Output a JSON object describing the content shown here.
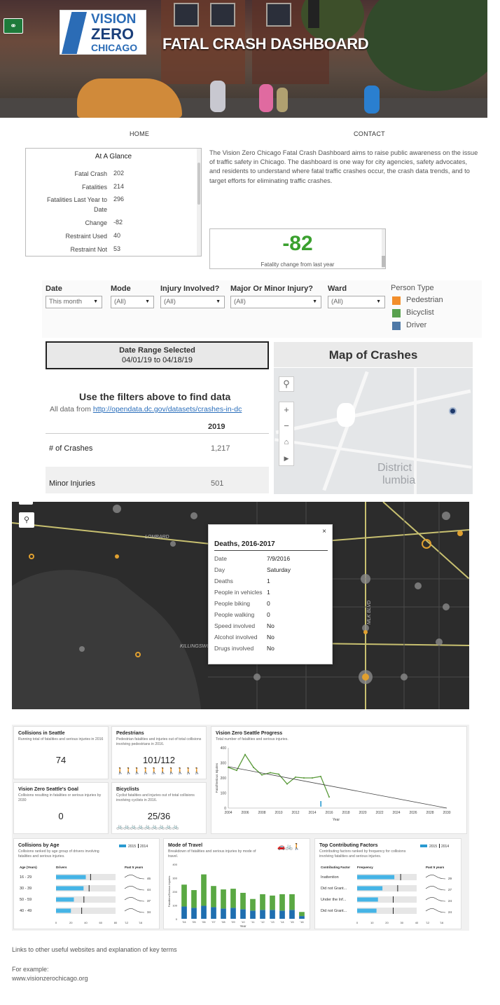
{
  "header": {
    "logo_line1": "VISION",
    "logo_line2": "ZERO",
    "logo_line3": "CHICAGO",
    "title": "FATAL CRASH DASHBOARD"
  },
  "nav": {
    "home": "HOME",
    "contact": "CONTACT"
  },
  "glance": {
    "title": "At A Glance",
    "rows": [
      {
        "label": "Fatal Crash",
        "value": "202"
      },
      {
        "label": "Fatalities",
        "value": "214"
      },
      {
        "label": "Fatalities Last Year to Date",
        "value": "296"
      },
      {
        "label": "Change",
        "value": "-82"
      },
      {
        "label": "Restraint Used",
        "value": "40"
      },
      {
        "label": "Restraint Not",
        "value": "53"
      }
    ]
  },
  "intro": "The Vision Zero Chicago Fatal Crash Dashboard aims to raise public awareness on the issue of traffic safety in Chicago. The dashboard is one way for city agencies, safety advocates, and residents to understand where fatal traffic crashes occur, the crash data trends, and to target efforts for eliminating traffic crashes.",
  "change": {
    "value": "-82",
    "caption": "Fatality change from last year",
    "color": "#3aa02e"
  },
  "filters": {
    "date": {
      "label": "Date",
      "value": "This month"
    },
    "mode": {
      "label": "Mode",
      "value": "(All)"
    },
    "injury": {
      "label": "Injury Involved?",
      "value": "(All)"
    },
    "severity": {
      "label": "Major Or Minor Injury?",
      "value": "(All)"
    },
    "ward": {
      "label": "Ward",
      "value": "(All)"
    }
  },
  "legend": {
    "title": "Person Type",
    "items": [
      {
        "label": "Pedestrian",
        "color": "#f28e2b"
      },
      {
        "label": "Bicyclist",
        "color": "#59a14f"
      },
      {
        "label": "Driver",
        "color": "#4e79a7"
      }
    ]
  },
  "date_range": {
    "title": "Date Range Selected",
    "value": "04/01/19 to 04/18/19"
  },
  "map": {
    "title": "Map of Crashes",
    "label1": "District",
    "label2": "lumbia"
  },
  "data_table": {
    "heading": "Use the filters above to find data",
    "source_prefix": "All data from ",
    "source_link": "http://opendata.dc.gov/datasets/crashes-in-dc",
    "year": "2019",
    "rows": [
      {
        "label": "# of Crashes",
        "value": "1,217"
      },
      {
        "label": "Minor Injuries",
        "value": "501"
      }
    ]
  },
  "dark_map": {
    "popup": {
      "title": "Deaths, 2016-2017",
      "close": "×",
      "rows": [
        {
          "label": "Date",
          "value": "7/9/2016"
        },
        {
          "label": "Day",
          "value": "Saturday"
        },
        {
          "label": "Deaths",
          "value": "1"
        },
        {
          "label": "People in vehicles",
          "value": "1"
        },
        {
          "label": "People biking",
          "value": "0"
        },
        {
          "label": "People walking",
          "value": "0"
        },
        {
          "label": "Speed involved",
          "value": "No"
        },
        {
          "label": "Alcohol involved",
          "value": "No"
        },
        {
          "label": "Drugs involved",
          "value": "No"
        }
      ]
    },
    "streets": [
      "LOMBARD",
      "KILLINGSWORTH",
      "MLK BLVD"
    ]
  },
  "seattle": {
    "collisions": {
      "title": "Collisions in Seattle",
      "sub": "Running total of fatalities and serious injuries in 2016",
      "value": "74"
    },
    "pedestrians": {
      "title": "Pedestrians",
      "sub": "Pedestrian fatalities and injuries out of total collisions involving pedestrians in 2016.",
      "value": "101/112"
    },
    "goal": {
      "title": "Vision Zero Seattle's Goal",
      "sub": "Collisions resulting in fatalities or serious injuries by 2030",
      "value": "0"
    },
    "bicyclists": {
      "title": "Bicyclists",
      "sub": "Cyclist fatalities and injuries out of total collisions involving cyclists in 2016.",
      "value": "25/36"
    },
    "progress": {
      "title": "Vision Zero Seattle Progress",
      "sub": "Total number of fatalities and serious injuries.",
      "ylabel": "Fatal/Serious Injuries",
      "xlabel": "Year"
    },
    "age": {
      "title": "Collisions by Age",
      "sub": "Collisions ranked by age group of drivers involving fatalities and serious injuries.",
      "col1": "Age (Years)",
      "col2": "Drivers",
      "col3": "Past 5 years",
      "legend_a": "2015",
      "legend_b": "2014",
      "rows": [
        {
          "label": "16 - 29",
          "value": 40,
          "tick": 46,
          "spark": "46"
        },
        {
          "label": "30 - 39",
          "value": 37,
          "tick": 44,
          "spark": "44"
        },
        {
          "label": "50 - 59",
          "value": 24,
          "tick": 37,
          "spark": "37"
        },
        {
          "label": "40 - 49",
          "value": 20,
          "tick": 34,
          "spark": "34"
        }
      ],
      "axis": [
        "0",
        "20",
        "40",
        "60",
        "80"
      ],
      "spark_axis": [
        "'12",
        "'16"
      ]
    },
    "travel": {
      "title": "Mode of Travel",
      "sub": "Breakdown of fatalities and serious injuries by mode of travel.",
      "ylabel": "Fatalities/Serious Injuries",
      "xlabel": "Year"
    },
    "factors": {
      "title": "Top Contributing Factors",
      "sub": "Contributing factors ranked by frequency for collisions involving fatalities and serious injuries.",
      "col1": "Contributing Factor",
      "col2": "Frequency",
      "col3": "Past 5 years",
      "legend_a": "2015",
      "legend_b": "2014",
      "rows": [
        {
          "label": "Inattention",
          "value": 25,
          "tick": 29,
          "spark": "29"
        },
        {
          "label": "Did not Grant...",
          "value": 17,
          "tick": 27,
          "spark": "27"
        },
        {
          "label": "Under the Inf...",
          "value": 14,
          "tick": 24,
          "spark": "24"
        },
        {
          "label": "Did not Grant...",
          "value": 13,
          "tick": 24,
          "spark": "24"
        }
      ],
      "axis": [
        "0",
        "10",
        "20",
        "30",
        "40"
      ],
      "spark_axis": [
        "'12",
        "'16"
      ]
    }
  },
  "chart_data": [
    {
      "type": "line",
      "title": "Vision Zero Seattle Progress",
      "xlabel": "Year",
      "ylabel": "Fatal/Serious Injuries",
      "x_ticks": [
        2004,
        2006,
        2008,
        2010,
        2012,
        2014,
        2016,
        2018,
        2020,
        2022,
        2024,
        2026,
        2028,
        2030
      ],
      "y_ticks": [
        0,
        100,
        200,
        300,
        400
      ],
      "xlim": [
        2004,
        2030
      ],
      "ylim": [
        0,
        400
      ],
      "series": [
        {
          "color": "#5a9a3a",
          "x": [
            2004,
            2005,
            2006,
            2007,
            2008,
            2009,
            2010,
            2011,
            2012,
            2013,
            2014,
            2015,
            2016
          ],
          "y": [
            270,
            250,
            355,
            270,
            220,
            235,
            225,
            160,
            205,
            200,
            200,
            210,
            74
          ]
        },
        {
          "color": "#444444",
          "x": [
            2004,
            2030
          ],
          "y": [
            275,
            0
          ]
        }
      ]
    },
    {
      "type": "bar",
      "title": "Mode of Travel",
      "xlabel": "Year",
      "ylabel": "Fatalities/Serious Injuries",
      "categories": [
        "'04",
        "'05",
        "'06",
        "'07",
        "'08",
        "'09",
        "'10",
        "'11",
        "'12",
        "'13",
        "'14",
        "'15",
        "'16"
      ],
      "y_ticks": [
        0,
        100,
        200,
        300,
        400
      ],
      "ylim": [
        0,
        400
      ],
      "series": [
        {
          "color": "#1f6fb0",
          "values": [
            90,
            80,
            95,
            85,
            75,
            80,
            70,
            60,
            65,
            65,
            60,
            65,
            20
          ]
        },
        {
          "color": "#5aa843",
          "values": [
            160,
            130,
            230,
            155,
            140,
            140,
            120,
            85,
            115,
            105,
            120,
            115,
            30
          ]
        }
      ]
    }
  ],
  "footer": {
    "links": "Links to other useful websites and explanation of key terms",
    "example": "For example:",
    "url": "www.visionzerochicago.org"
  }
}
